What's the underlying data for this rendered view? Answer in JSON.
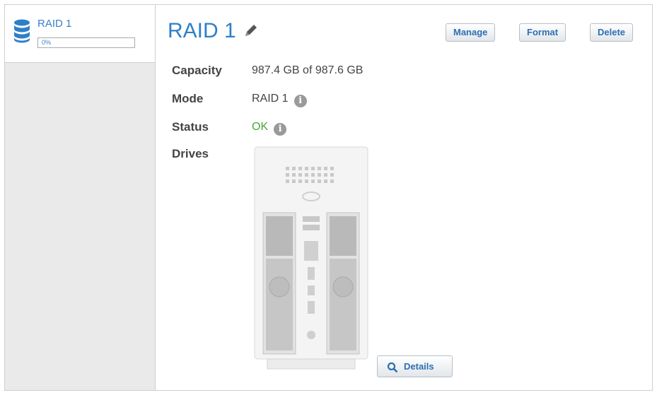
{
  "sidebar": {
    "volume": {
      "label": "RAID 1",
      "progress_text": "0%",
      "progress": 0
    }
  },
  "header": {
    "title": "RAID 1"
  },
  "toolbar": {
    "manage_label": "Manage",
    "format_label": "Format",
    "delete_label": "Delete"
  },
  "details": {
    "capacity": {
      "label": "Capacity",
      "value": "987.4 GB of 987.6 GB"
    },
    "mode": {
      "label": "Mode",
      "value": "RAID 1"
    },
    "status": {
      "label": "Status",
      "value": "OK"
    },
    "drives": {
      "label": "Drives"
    }
  },
  "details_button": {
    "label": "Details"
  },
  "icons": {
    "info_glyph": "i"
  },
  "colors": {
    "accent": "#2f7fc8",
    "status_ok": "#4aa63a",
    "button_text": "#2c6fb3"
  }
}
